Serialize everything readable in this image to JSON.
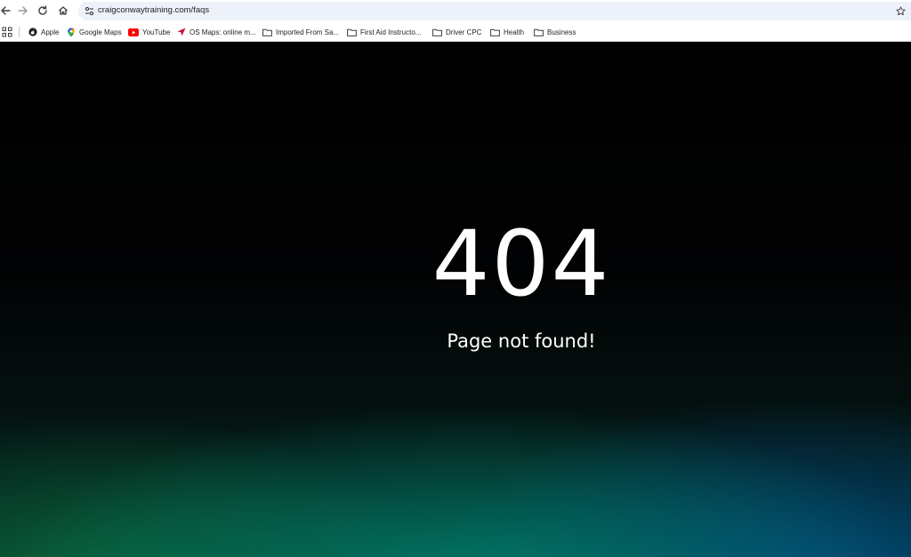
{
  "browser": {
    "url": "craigconwaytraining.com/faqs"
  },
  "bookmarks": [
    {
      "label": "Apple",
      "icon": "apple-icon"
    },
    {
      "label": "Google Maps",
      "icon": "google-maps-icon"
    },
    {
      "label": "YouTube",
      "icon": "youtube-icon"
    },
    {
      "label": "OS Maps: online m...",
      "icon": "os-maps-icon"
    },
    {
      "label": "Imported From Sa...",
      "icon": "folder-icon"
    },
    {
      "label": "First Aid Instructo...",
      "icon": "folder-icon"
    },
    {
      "label": "Driver CPC",
      "icon": "folder-icon"
    },
    {
      "label": "Health",
      "icon": "folder-icon"
    },
    {
      "label": "Business",
      "icon": "folder-icon"
    }
  ],
  "page": {
    "error_code": "404",
    "message": "Page not found!"
  },
  "colors": {
    "youtube_red": "#ff0000",
    "os_maps_accent": "#c8102e",
    "omnibox_bg": "#edf1f9"
  }
}
